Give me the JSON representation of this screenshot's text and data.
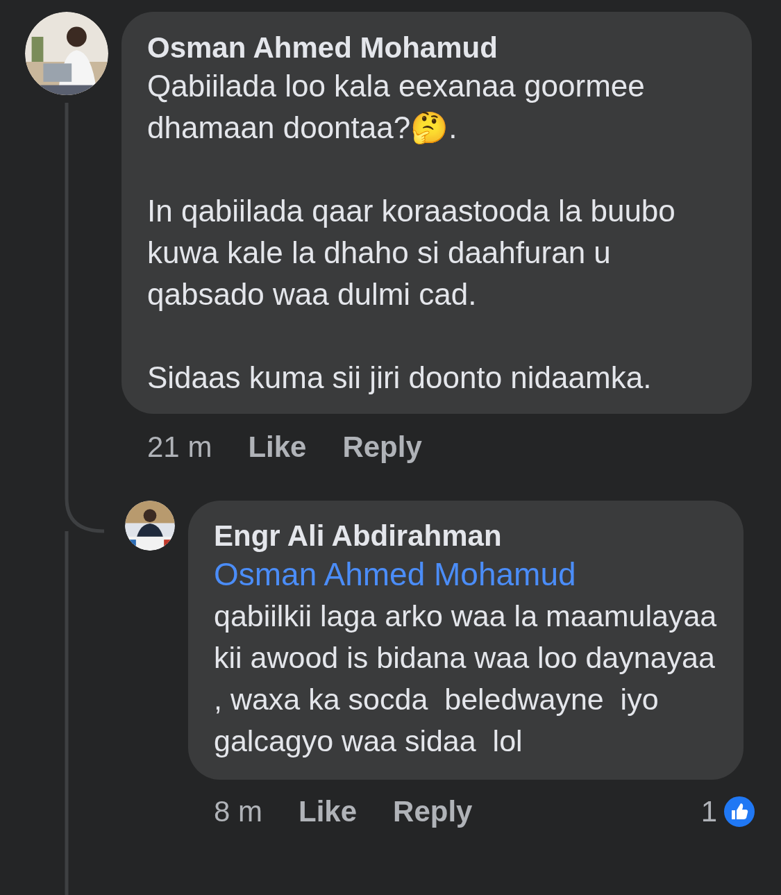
{
  "comments": [
    {
      "author": "Osman Ahmed Mohamud",
      "paragraphs": [
        "Qabiilada loo kala eexanaa goormee dhamaan doontaa?🤔.",
        "In qabiilada qaar koraastooda la buubo kuwa kale la dhaho si daahfuran u qabsado waa dulmi cad.",
        "Sidaas kuma sii jiri doonto nidaamka."
      ],
      "time": "21 m",
      "like": "Like",
      "reply": "Reply",
      "replies": [
        {
          "author": "Engr Ali Abdirahman",
          "mention": "Osman Ahmed Mohamud",
          "paragraphs": [
            "qabiilkii laga arko waa la maamulayaa kii awood is bidana waa loo daynayaa , waxa ka socda  beledwayne  iyo galcagyo waa sidaa  lol"
          ],
          "time": "8 m",
          "like": "Like",
          "reply": "Reply",
          "reaction_count": "1"
        }
      ]
    }
  ]
}
